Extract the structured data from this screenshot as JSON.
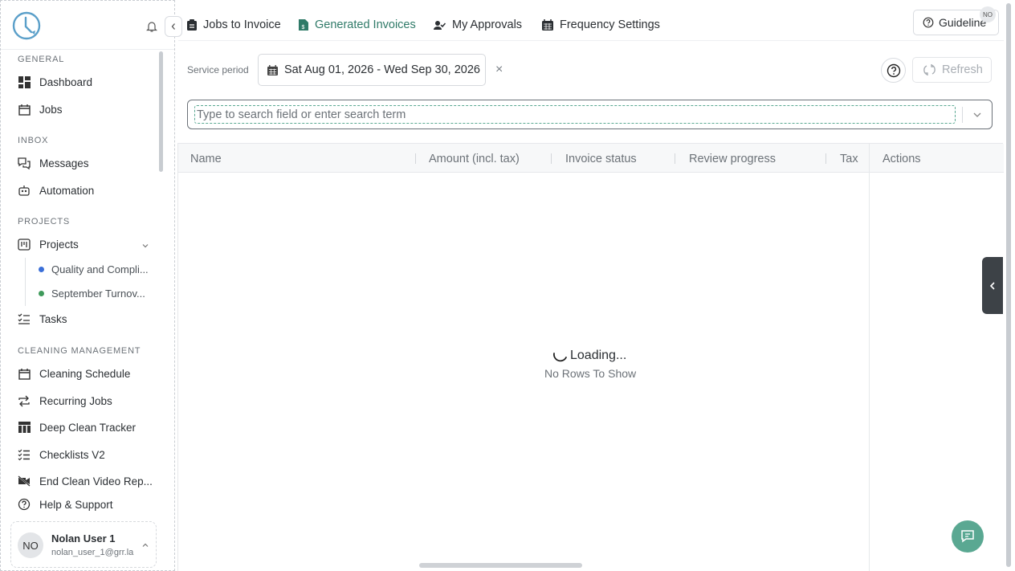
{
  "sidebar": {
    "sections": {
      "general": "GENERAL",
      "inbox": "INBOX",
      "projects": "PROJECTS",
      "cleaning": "CLEANING MANAGEMENT"
    },
    "items": {
      "dashboard": "Dashboard",
      "jobs": "Jobs",
      "messages": "Messages",
      "automation": "Automation",
      "projects": "Projects",
      "tasks": "Tasks",
      "cleaning_schedule": "Cleaning Schedule",
      "recurring_jobs": "Recurring Jobs",
      "deep_clean_tracker": "Deep Clean Tracker",
      "checklists_v2": "Checklists V2",
      "end_clean_video": "End Clean Video Rep...",
      "help_support": "Help & Support"
    },
    "sub_projects": [
      {
        "label": "Quality and Compli...",
        "color": "#3b6fd8"
      },
      {
        "label": "September Turnov...",
        "color": "#3f9a5b"
      }
    ],
    "user": {
      "initials": "NO",
      "name": "Nolan User 1",
      "email": "nolan_user_1@grr.la"
    }
  },
  "tabs": {
    "jobs_to_invoice": "Jobs to Invoice",
    "generated_invoices": "Generated Invoices",
    "my_approvals": "My Approvals",
    "frequency_settings": "Frequency Settings"
  },
  "header": {
    "guideline_label": "Guideline",
    "badge": "NO"
  },
  "filters": {
    "service_period_label": "Service period",
    "date_range": "Sat Aug 01, 2026 - Wed Sep 30, 2026",
    "clear": "×",
    "refresh_label": "Refresh"
  },
  "search": {
    "placeholder": "Type to search field or enter search term",
    "value": ""
  },
  "grid": {
    "columns": {
      "name": "Name",
      "amount": "Amount (incl. tax)",
      "status": "Invoice status",
      "review": "Review progress",
      "tax": "Tax",
      "actions": "Actions"
    },
    "loading_text": "Loading...",
    "empty_text": "No Rows To Show"
  },
  "colors": {
    "accent": "#2f7a68",
    "fab": "#5aa892"
  }
}
